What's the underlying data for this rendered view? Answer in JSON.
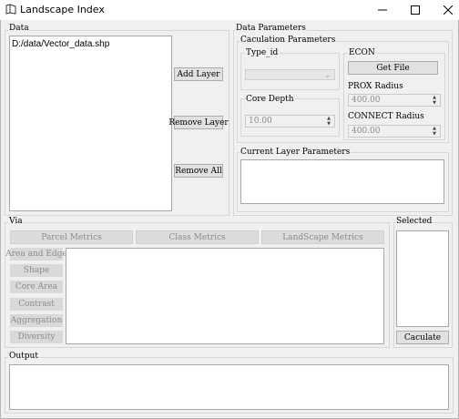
{
  "window": {
    "title": "Landscape Index",
    "controls": [
      "minimize-icon",
      "maximize-icon",
      "close-icon"
    ]
  },
  "data_group": {
    "label": "Data",
    "layers": [
      "D:/data/Vector_data.shp"
    ],
    "add_label": "Add Layer",
    "remove_label": "Remove Layer",
    "remove_all_label": "Remove All"
  },
  "params_group": {
    "label": "Data Parameters",
    "calc": {
      "label": "Caculation Parameters",
      "type_id_label": "Type_id",
      "type_id_value": "",
      "core_depth_label": "Core Depth",
      "core_depth_value": "10.00",
      "econ_label": "ECON",
      "get_file_label": "Get File",
      "prox_label": "PROX Radius",
      "prox_value": "400.00",
      "connect_label": "CONNECT Radius",
      "connect_value": "400.00"
    },
    "current_label": "Current Layer Parameters"
  },
  "via_group": {
    "label": "Via",
    "tabs": [
      "Parcel Metrics",
      "Class Metrics",
      "LandScape Metrics"
    ],
    "side": [
      "Area and Edge",
      "Shape",
      "Core Area",
      "Contrast",
      "Aggregation",
      "Diversity"
    ]
  },
  "selected_group": {
    "label": "Selected",
    "caculate_label": "Caculate"
  },
  "output_group": {
    "label": "Output"
  }
}
